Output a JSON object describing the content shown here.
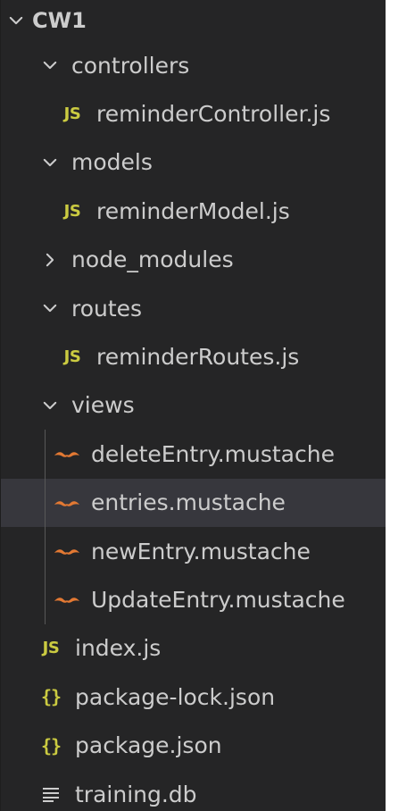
{
  "explorer": {
    "root": {
      "label": "CW1",
      "state": "expanded"
    },
    "items": [
      {
        "label": "controllers",
        "kind": "folder",
        "state": "expanded",
        "depth": 1
      },
      {
        "label": "reminderController.js",
        "kind": "js",
        "depth": 2,
        "icon_text": "JS"
      },
      {
        "label": "models",
        "kind": "folder",
        "state": "expanded",
        "depth": 1
      },
      {
        "label": "reminderModel.js",
        "kind": "js",
        "depth": 2,
        "icon_text": "JS"
      },
      {
        "label": "node_modules",
        "kind": "folder",
        "state": "collapsed",
        "depth": 1
      },
      {
        "label": "routes",
        "kind": "folder",
        "state": "expanded",
        "depth": 1
      },
      {
        "label": "reminderRoutes.js",
        "kind": "js",
        "depth": 2,
        "icon_text": "JS"
      },
      {
        "label": "views",
        "kind": "folder",
        "state": "expanded",
        "depth": 1
      },
      {
        "label": "deleteEntry.mustache",
        "kind": "mustache",
        "depth": 2
      },
      {
        "label": "entries.mustache",
        "kind": "mustache",
        "depth": 2,
        "selected": true
      },
      {
        "label": "newEntry.mustache",
        "kind": "mustache",
        "depth": 2
      },
      {
        "label": "UpdateEntry.mustache",
        "kind": "mustache",
        "depth": 2
      },
      {
        "label": "index.js",
        "kind": "js",
        "depth": 1,
        "icon_text": "JS"
      },
      {
        "label": "package-lock.json",
        "kind": "json",
        "depth": 1,
        "icon_text": "{}"
      },
      {
        "label": "package.json",
        "kind": "json",
        "depth": 1,
        "icon_text": "{}"
      },
      {
        "label": "training.db",
        "kind": "db",
        "depth": 1
      }
    ]
  },
  "colors": {
    "sidebar_bg": "#252526",
    "selected_bg": "#37373d",
    "text": "#cccccc",
    "js_icon": "#cbcb41",
    "json_icon": "#cbcb41",
    "mustache_icon": "#e37933",
    "indent_guide": "#585858"
  },
  "icons": {
    "expanded": "chevron-down-icon",
    "collapsed": "chevron-right-icon",
    "js": "js-file-icon",
    "json": "json-file-icon",
    "mustache": "mustache-file-icon",
    "db": "text-lines-file-icon"
  }
}
